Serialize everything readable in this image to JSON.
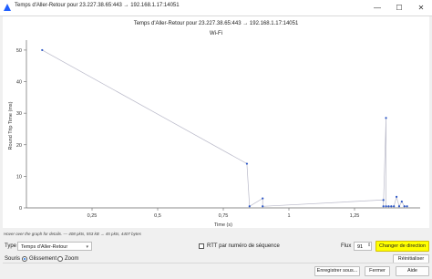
{
  "window": {
    "title": "Temps d'Aller-Retour pour 23.227.38.65:443 → 192.168.1.17:14051",
    "minimize_label": "—",
    "maximize_label": "☐",
    "close_label": "✕"
  },
  "colors": {
    "accent": "#1f5eff",
    "series": "#b8b8c8",
    "marker": "#2b56c6",
    "highlight": "#ffff00"
  },
  "plot": {
    "title": "Temps d'Aller-Retour pour 23.227.38.65:443 → 192.168.1.17:14051",
    "subtitle": "Wi-Fi"
  },
  "chart_data": {
    "type": "line",
    "title": "Temps d'Aller-Retour pour 23.227.38.65:443 → 192.168.1.17:14051",
    "subtitle": "Wi-Fi",
    "xlabel": "Time (s)",
    "ylabel": "Round Trip Time (ms)",
    "xlim": [
      0,
      1.5
    ],
    "ylim": [
      0,
      52
    ],
    "xticks": [
      0.25,
      0.5,
      0.75,
      1,
      1.25
    ],
    "xtick_labels": [
      "0,25",
      "0,5",
      "0,75",
      "1",
      "1,25"
    ],
    "yticks": [
      0,
      10,
      20,
      30,
      40,
      50
    ],
    "grid": false,
    "x": [
      0.06,
      0.84,
      0.85,
      0.9,
      0.9,
      1.36,
      1.36,
      1.37,
      1.37,
      1.38,
      1.39,
      1.4,
      1.41,
      1.42,
      1.43,
      1.44,
      1.45
    ],
    "y": [
      50,
      14,
      0.5,
      3,
      0.5,
      2.5,
      0.5,
      28.5,
      0.5,
      0.5,
      0.5,
      0.5,
      3.5,
      0.5,
      2,
      0.5,
      0.5
    ]
  },
  "hint": "Hover over the graph for details. — 408 pkts, 553 kB → 45 pkts, 4407 bytes",
  "controls": {
    "type_label": "Type",
    "type_value": "Temps d'Aller-Retour",
    "rtt_label": "RTT par numéro de séquence",
    "stream_label": "Flux",
    "stream_value": "91",
    "switch_direction": "Changer de direction",
    "mouse_label": "Souris",
    "drag_label": "Glissement",
    "zoom_label": "Zoom",
    "reset_label": "Réinitialiser",
    "save_label": "Enregistrer sous...",
    "close_label": "Fermer",
    "help_label": "Aide"
  }
}
